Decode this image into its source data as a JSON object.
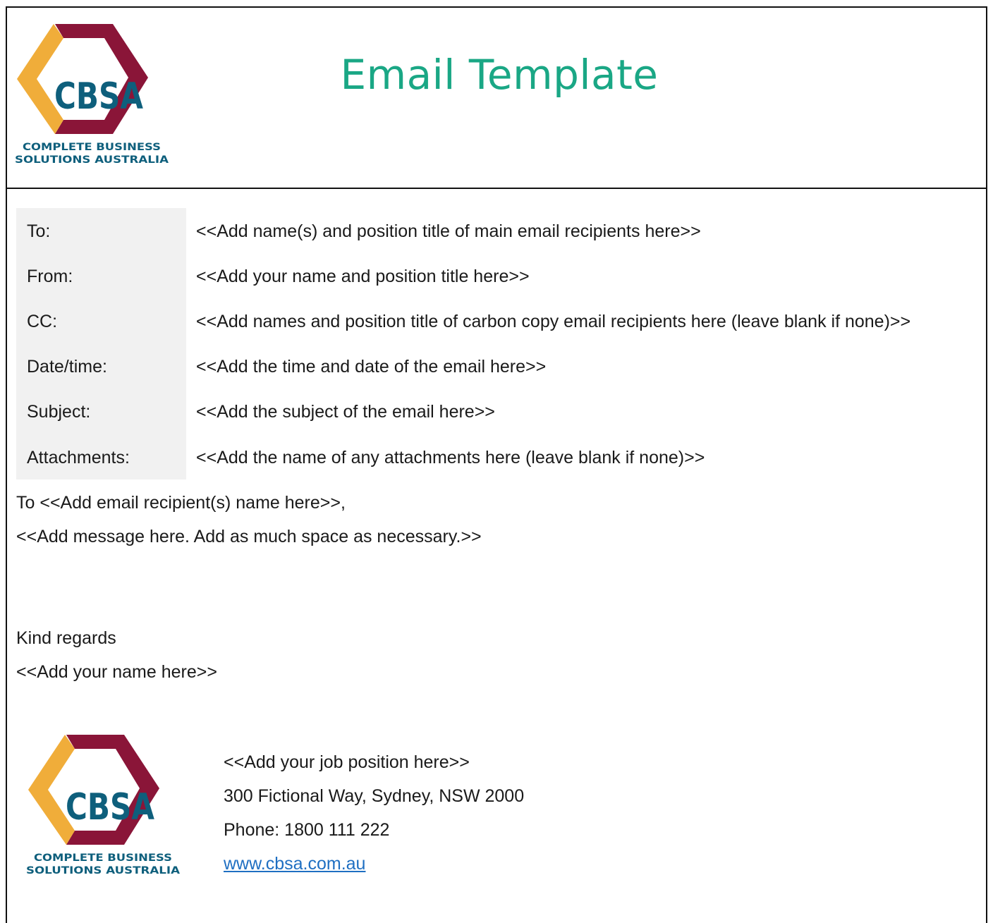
{
  "header": {
    "title": "Email Template",
    "logo": {
      "mark_text": "CBSA",
      "line1": "COMPLETE BUSINESS",
      "line2": "SOLUTIONS AUSTRALIA",
      "colors": {
        "maroon": "#8a1538",
        "gold": "#f0ad3a",
        "teal": "#0e5f7c"
      }
    }
  },
  "fields": [
    {
      "label": "To:",
      "value": "<<Add name(s) and position title of main email recipients here>>"
    },
    {
      "label": "From:",
      "value": "<<Add your name and position title here>>"
    },
    {
      "label": "CC:",
      "value": "<<Add names and position title of carbon copy email recipients here (leave blank if none)>>"
    },
    {
      "label": "Date/time:",
      "value": "<<Add the time and date of the email here>>"
    },
    {
      "label": "Subject:",
      "value": "<<Add the subject of the email here>>"
    },
    {
      "label": "Attachments:",
      "value": "<<Add the name of any attachments here (leave blank if none)>>"
    }
  ],
  "body": {
    "greeting": "To <<Add email recipient(s) name here>>,",
    "message": "<<Add message here. Add as much space as necessary.>>",
    "closing": "Kind regards",
    "sender_name": "<<Add your name here>>"
  },
  "signature": {
    "position": "<<Add your job position here>>",
    "address": "300 Fictional Way, Sydney, NSW 2000",
    "phone": "Phone: 1800 111 222",
    "website": "www.cbsa.com.au"
  },
  "colors": {
    "title": "#1aa785",
    "label_background": "#f1f1f1",
    "link": "#1f6fc2"
  }
}
